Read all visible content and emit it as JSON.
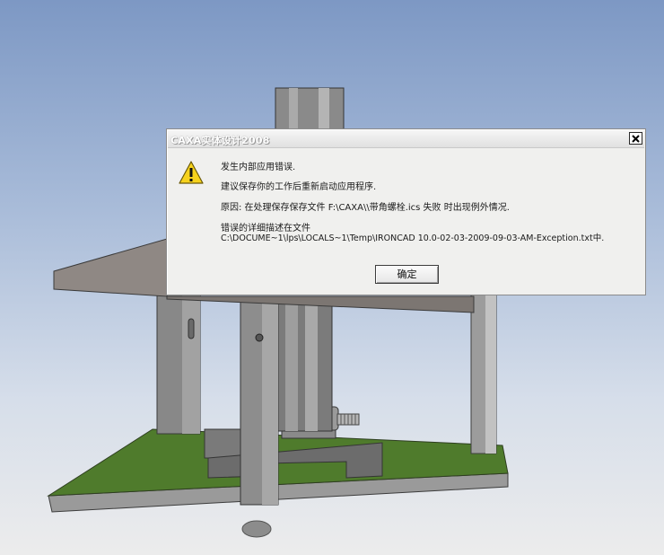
{
  "dialog": {
    "title": "CAXA实体设计2008",
    "message_line1": "发生内部应用错误.",
    "message_line2": "建议保存你的工作后重新启动应用程序.",
    "message_line3": "原因: 在处理保存保存文件 F:\\CAXA\\\\带角螺栓.ics 失败 时出现例外情况.",
    "message_line4": "错误的详细描述在文件",
    "message_line5": "C:\\DOCUME~1\\lps\\LOCALS~1\\Temp\\IRONCAD 10.0-02-03-2009-09-03-AM-Exception.txt中.",
    "ok_label": "确定",
    "icon": "warning-icon"
  },
  "colors": {
    "sky_top": "#7d98c4",
    "base_plate": "#4e7a2a",
    "part_gray": "#8a8a8a"
  }
}
